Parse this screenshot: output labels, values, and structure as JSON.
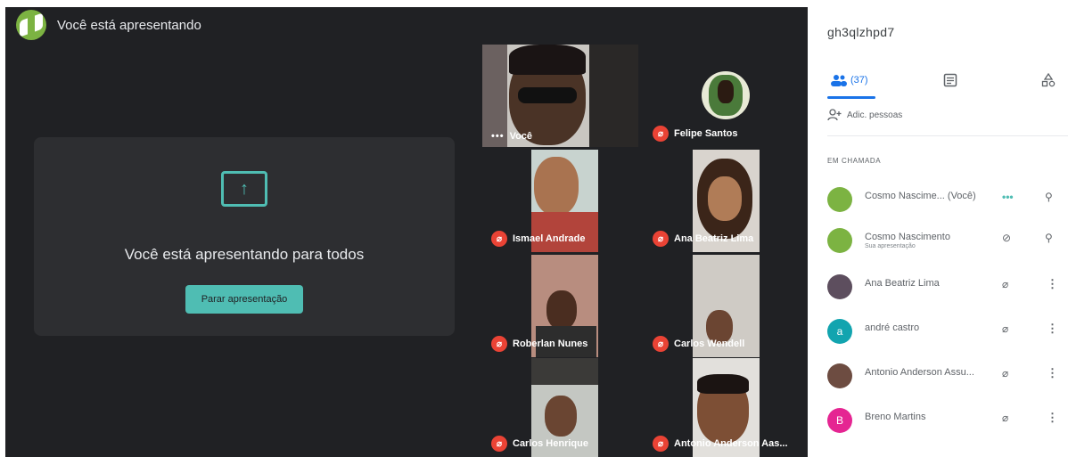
{
  "presenting_banner": "Você está apresentando",
  "presentation_card": {
    "message": "Você está apresentando para todos",
    "stop_button": "Parar apresentação"
  },
  "tiles": [
    {
      "name": "Você",
      "muted": false
    },
    {
      "name": "Felipe Santos",
      "muted": true
    },
    {
      "name": "Ismael Andrade",
      "muted": true
    },
    {
      "name": "Ana Beatriz Lima",
      "muted": true
    },
    {
      "name": "Roberlan Nunes",
      "muted": true
    },
    {
      "name": "Carlos Wendell",
      "muted": true
    },
    {
      "name": "Carlos Henrique",
      "muted": true
    },
    {
      "name": "Antonio Anderson Aas...",
      "muted": true
    }
  ],
  "sidebar": {
    "meeting_code": "gh3qlzhpd7",
    "people_tab_count": "(37)",
    "add_people": "Adic. pessoas",
    "section_label": "EM CHAMADA",
    "participants": [
      {
        "name": "Cosmo Nascime... (Você)",
        "sub": "",
        "avatar_color": "#7cb342",
        "avatar_letter": ""
      },
      {
        "name": "Cosmo Nascimento",
        "sub": "Sua apresentação",
        "avatar_color": "#7cb342",
        "avatar_letter": ""
      },
      {
        "name": "Ana Beatriz Lima",
        "sub": "",
        "avatar_color": "#5d4e5e",
        "avatar_letter": ""
      },
      {
        "name": "andré castro",
        "sub": "",
        "avatar_color": "#12a4af",
        "avatar_letter": "a"
      },
      {
        "name": "Antonio Anderson Assu...",
        "sub": "",
        "avatar_color": "#6d4c41",
        "avatar_letter": ""
      },
      {
        "name": "Breno Martins",
        "sub": "",
        "avatar_color": "#e52592",
        "avatar_letter": "B"
      }
    ]
  },
  "colors": {
    "accent": "#4fbdb3",
    "background": "#202124",
    "muted": "#ea4335",
    "tab_active": "#1a73e8"
  }
}
